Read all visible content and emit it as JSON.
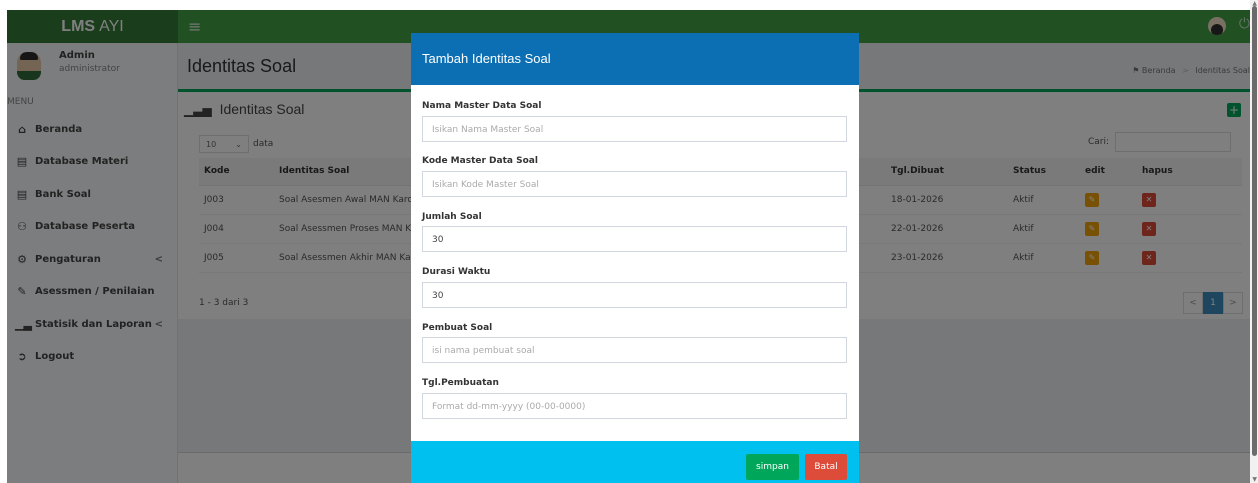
{
  "header": {
    "logo_bold": "LMS",
    "logo_rest": "AYI"
  },
  "user": {
    "name": "Admin",
    "role": "administrator"
  },
  "sidebar": {
    "menu_label": "MENU",
    "items": [
      {
        "label": "Beranda",
        "icon": "home-icon"
      },
      {
        "label": "Database Materi",
        "icon": "book-icon"
      },
      {
        "label": "Bank Soal",
        "icon": "book-icon"
      },
      {
        "label": "Database Peserta",
        "icon": "users-icon"
      },
      {
        "label": "Pengaturan",
        "icon": "gear-icon"
      },
      {
        "label": "Asessmen / Penilaian",
        "icon": "edit-icon"
      },
      {
        "label": "Statisik dan Laporan",
        "icon": "bar-chart-icon"
      },
      {
        "label": "Logout",
        "icon": "sign-out-icon"
      }
    ]
  },
  "page": {
    "title": "Identitas Soal",
    "breadcrumb": [
      "Beranda",
      "Identitas Soal"
    ],
    "box_title": "Identitas Soal",
    "length_value": "10",
    "length_suffix": "data",
    "search_label": "Cari:",
    "info": "1 - 3 dari 3",
    "pagination": [
      "<",
      "1",
      ">"
    ]
  },
  "table": {
    "headers": [
      "Kode",
      "Identitas Soal",
      "Tgl.Dibuat",
      "Status",
      "edit",
      "hapus"
    ],
    "rows": [
      {
        "kode": "J003",
        "identitas": "Soal Asesmen Awal MAN Karo",
        "tgl": "18-01-2026",
        "status": "Aktif"
      },
      {
        "kode": "J004",
        "identitas": "Soal Asessmen Proses MAN Kar",
        "tgl": "22-01-2026",
        "status": "Aktif"
      },
      {
        "kode": "J005",
        "identitas": "Soal Asessmen Akhir MAN Karo",
        "tgl": "23-01-2026",
        "status": "Aktif"
      }
    ]
  },
  "modal": {
    "title": "Tambah Identitas Soal",
    "fields": [
      {
        "label": "Nama Master Data Soal",
        "value": "",
        "placeholder": "Isikan Nama Master Soal"
      },
      {
        "label": "Kode Master Data Soal",
        "value": "",
        "placeholder": "Isikan Kode Master Soal"
      },
      {
        "label": "Jumlah Soal",
        "value": "30",
        "placeholder": ""
      },
      {
        "label": "Durasi Waktu",
        "value": "30",
        "placeholder": ""
      },
      {
        "label": "Pembuat Soal",
        "value": "",
        "placeholder": "isi nama pembuat soal"
      },
      {
        "label": "Tgl.Pembuatan",
        "value": "",
        "placeholder": "Format dd-mm-yyyy (00-00-0000)"
      }
    ],
    "save_label": "simpan",
    "cancel_label": "Batal"
  },
  "colors": {
    "header_green": "#43a047",
    "logo_green": "#357a38",
    "modal_header_blue": "#0c6fb4",
    "modal_footer_cyan": "#00c0ef",
    "save_green": "#00a65a",
    "cancel_red": "#dd4b39",
    "edit_orange": "#f0a30a"
  }
}
